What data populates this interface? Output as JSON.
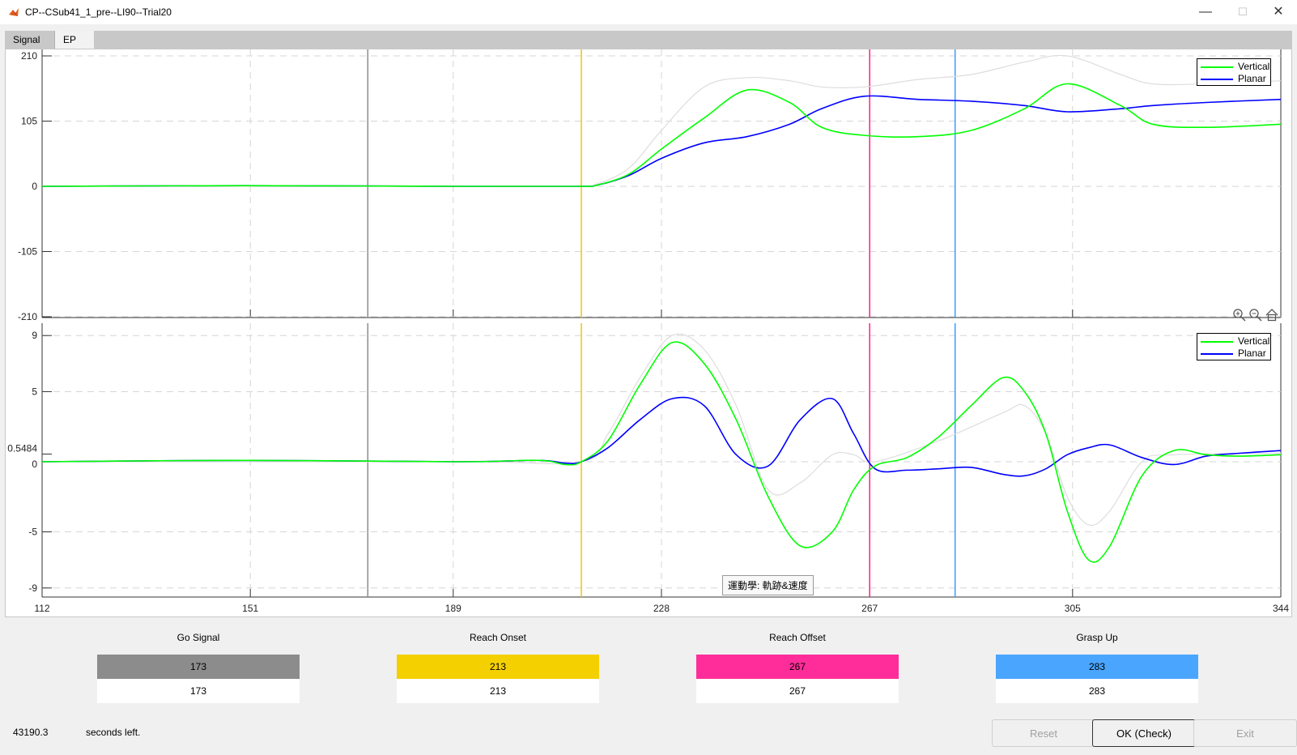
{
  "window": {
    "title": "CP--CSub41_1_pre--LI90--Trial20",
    "minimize_glyph": "—",
    "maximize_glyph": "☐",
    "close_glyph": "✕",
    "icon": "matlab-icon"
  },
  "tabs": [
    {
      "label": "Signal"
    },
    {
      "label": "EP"
    }
  ],
  "chart_data": [
    {
      "type": "line",
      "title": "",
      "xlim": [
        112,
        344
      ],
      "ylim": [
        -210,
        210
      ],
      "yticks": [
        210,
        105,
        0,
        -105,
        -210
      ],
      "xticks": [
        112,
        151,
        189,
        228,
        267,
        305,
        344
      ],
      "grid": true,
      "legend": "top-right",
      "series": [
        {
          "name": "Vertical",
          "color": "#00ff00",
          "x": [
            112,
            150,
            190,
            212,
            216,
            222,
            228,
            236,
            244,
            252,
            258,
            266,
            276,
            286,
            296,
            304,
            314,
            320,
            330,
            344
          ],
          "y": [
            0,
            1,
            0,
            0,
            2,
            20,
            60,
            110,
            155,
            135,
            95,
            82,
            80,
            90,
            125,
            165,
            130,
            100,
            95,
            100
          ]
        },
        {
          "name": "Planar",
          "color": "#0000ff",
          "x": [
            112,
            150,
            190,
            212,
            216,
            222,
            228,
            236,
            244,
            252,
            258,
            266,
            276,
            286,
            296,
            304,
            314,
            320,
            330,
            344
          ],
          "y": [
            0,
            1,
            0,
            0,
            2,
            18,
            45,
            70,
            80,
            100,
            125,
            145,
            140,
            137,
            130,
            120,
            125,
            130,
            135,
            140
          ]
        },
        {
          "name": "",
          "color": "#dddddd",
          "x": [
            112,
            190,
            212,
            216,
            222,
            228,
            236,
            244,
            252,
            258,
            266,
            276,
            286,
            296,
            304,
            314,
            320,
            330,
            344
          ],
          "y": [
            0,
            0,
            0,
            4,
            30,
            90,
            160,
            175,
            170,
            160,
            160,
            172,
            180,
            200,
            210,
            180,
            165,
            165,
            170
          ]
        }
      ],
      "vlines": [
        {
          "x": 173,
          "color": "#8c8c8c"
        },
        {
          "x": 213,
          "color": "#f5c400"
        },
        {
          "x": 267,
          "color": "#ff1e8c"
        },
        {
          "x": 283,
          "color": "#3c9bff"
        }
      ]
    },
    {
      "type": "line",
      "title": "",
      "xlim": [
        112,
        344
      ],
      "ylim": [
        -10,
        10
      ],
      "yticks": [
        9,
        5,
        0.5484,
        0,
        -5,
        -9
      ],
      "xticks": [
        112,
        151,
        189,
        228,
        267,
        305,
        344
      ],
      "grid": true,
      "legend": "top-right",
      "series": [
        {
          "name": "Vertical",
          "color": "#00ff00",
          "x": [
            112,
            150,
            190,
            205,
            210,
            213,
            218,
            224,
            230,
            236,
            242,
            248,
            254,
            260,
            264,
            268,
            274,
            280,
            286,
            292,
            296,
            300,
            304,
            308,
            312,
            318,
            324,
            330,
            336,
            344
          ],
          "y": [
            0,
            0.1,
            0,
            0.1,
            -0.2,
            0,
            1.5,
            5.5,
            8.5,
            7.0,
            3.0,
            -2.5,
            -6.0,
            -5.0,
            -2.0,
            -0.3,
            0.3,
            1.8,
            4.0,
            6.0,
            5.0,
            2.0,
            -3.5,
            -7.0,
            -6.0,
            -1.0,
            0.8,
            0.5,
            0.4,
            0.5
          ]
        },
        {
          "name": "Planar",
          "color": "#0000ff",
          "x": [
            112,
            150,
            190,
            205,
            210,
            213,
            218,
            224,
            230,
            236,
            242,
            248,
            254,
            260,
            264,
            268,
            274,
            280,
            286,
            292,
            296,
            300,
            304,
            308,
            312,
            318,
            324,
            330,
            336,
            344
          ],
          "y": [
            0,
            0.1,
            0,
            0.1,
            -0.1,
            0,
            1.0,
            3.0,
            4.5,
            4.0,
            0.5,
            -0.3,
            3.0,
            4.5,
            2.0,
            -0.5,
            -0.6,
            -0.5,
            -0.4,
            -0.9,
            -1.0,
            -0.5,
            0.5,
            1.0,
            1.2,
            0.3,
            -0.2,
            0.4,
            0.6,
            0.8
          ]
        },
        {
          "name": "",
          "color": "#dddddd",
          "x": [
            112,
            190,
            213,
            218,
            224,
            230,
            236,
            242,
            248,
            254,
            260,
            264,
            268,
            280,
            292,
            296,
            300,
            304,
            308,
            312,
            318,
            324,
            344
          ],
          "y": [
            0,
            0,
            0,
            2,
            6,
            9,
            8,
            4,
            -2.0,
            -1.5,
            0.5,
            0.5,
            0.0,
            1.5,
            3.5,
            4.0,
            2.0,
            -2.5,
            -4.5,
            -3.5,
            0.0,
            0.5,
            0.6
          ]
        }
      ],
      "vlines": [
        {
          "x": 173,
          "color": "#8c8c8c"
        },
        {
          "x": 213,
          "color": "#f5c400"
        },
        {
          "x": 267,
          "color": "#ff1e8c"
        },
        {
          "x": 283,
          "color": "#3c9bff"
        }
      ]
    }
  ],
  "legend": {
    "vertical": "Vertical",
    "planar": "Planar"
  },
  "plot_tooltip": "運動學: 軌跡&速度",
  "toolbar": {
    "zoom_in": "zoom-in-icon",
    "zoom_out": "zoom-out-icon",
    "home": "home-icon"
  },
  "events": [
    {
      "title": "Go Signal",
      "value": "173",
      "input": "173",
      "color": "#8c8c8c"
    },
    {
      "title": "Reach Onset",
      "value": "213",
      "input": "213",
      "color": "#f5d000"
    },
    {
      "title": "Reach Offset",
      "value": "267",
      "input": "267",
      "color": "#ff2d9a"
    },
    {
      "title": "Grasp Up",
      "value": "283",
      "input": "283",
      "color": "#4aa5ff"
    }
  ],
  "status": {
    "timer_value": "43190.3",
    "timer_label": "seconds left."
  },
  "buttons": {
    "reset": "Reset",
    "ok": "OK (Check)",
    "exit": "Exit"
  }
}
